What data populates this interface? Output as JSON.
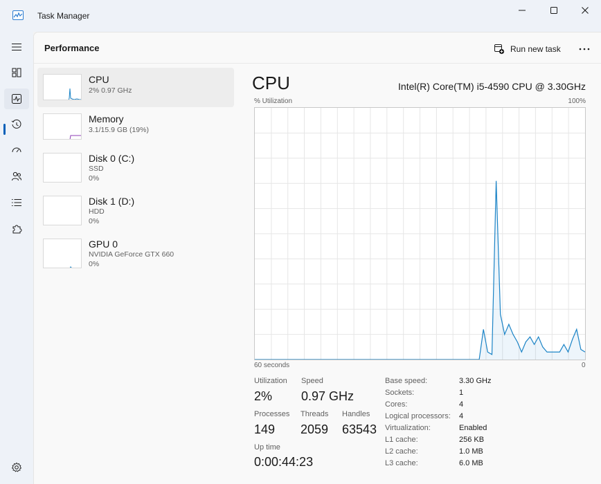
{
  "window": {
    "title": "Task Manager"
  },
  "nav": {
    "items": [
      {
        "name": "nav-processes",
        "icon": "hamburger-icon"
      },
      {
        "name": "nav-apps",
        "icon": "grid-icon"
      },
      {
        "name": "nav-performance",
        "icon": "pulse-icon",
        "active": true
      },
      {
        "name": "nav-app-history",
        "icon": "history-icon"
      },
      {
        "name": "nav-startup",
        "icon": "gauge-icon"
      },
      {
        "name": "nav-users",
        "icon": "users-icon"
      },
      {
        "name": "nav-details",
        "icon": "list-icon"
      },
      {
        "name": "nav-services",
        "icon": "puzzle-icon"
      }
    ],
    "settings_icon": "gear-icon"
  },
  "header": {
    "page_title": "Performance",
    "run_new_task": "Run new task"
  },
  "resources": [
    {
      "name": "CPU",
      "line1": "2%  0.97 GHz",
      "selected": true,
      "color": "#1a83c6"
    },
    {
      "name": "Memory",
      "line1": "3.1/15.9 GB (19%)",
      "color": "#8e3cb4"
    },
    {
      "name": "Disk 0 (C:)",
      "line1": "SSD",
      "line2": "0%",
      "color": "#4ca02a"
    },
    {
      "name": "Disk 1 (D:)",
      "line1": "HDD",
      "line2": "0%",
      "color": "#4ca02a"
    },
    {
      "name": "GPU 0",
      "line1": "NVIDIA GeForce GTX 660",
      "line2": "0%",
      "color": "#1a83c6"
    }
  ],
  "detail": {
    "title": "CPU",
    "model": "Intel(R) Core(TM) i5-4590 CPU @ 3.30GHz",
    "graph_label": "% Utilization",
    "graph_max": "100%",
    "graph_time": "60 seconds",
    "graph_min": "0",
    "line_color": "#1a83c6",
    "cpu_history_percent": [
      0,
      0,
      0,
      0,
      0,
      0,
      0,
      0,
      0,
      0,
      0,
      0,
      0,
      0,
      0,
      0,
      0,
      0,
      0,
      0,
      0,
      0,
      0,
      0,
      0,
      0,
      0,
      0,
      0,
      0,
      0,
      0,
      0,
      0,
      0,
      0,
      0,
      0,
      0,
      0,
      0,
      0,
      0,
      0,
      0,
      0,
      0,
      0,
      0,
      0,
      0,
      0,
      0,
      0,
      12,
      3,
      2,
      71,
      18,
      10,
      14,
      10,
      7,
      3,
      7,
      9,
      6,
      9,
      5,
      3,
      3,
      3,
      3,
      6,
      3,
      8,
      12,
      4,
      3
    ]
  },
  "stats": {
    "utilization_label": "Utilization",
    "utilization": "2%",
    "speed_label": "Speed",
    "speed": "0.97 GHz",
    "processes_label": "Processes",
    "processes": "149",
    "threads_label": "Threads",
    "threads": "2059",
    "handles_label": "Handles",
    "handles": "63543",
    "uptime_label": "Up time",
    "uptime": "0:00:44:23"
  },
  "info": {
    "base_speed_label": "Base speed:",
    "base_speed": "3.30 GHz",
    "sockets_label": "Sockets:",
    "sockets": "1",
    "cores_label": "Cores:",
    "cores": "4",
    "logical_label": "Logical processors:",
    "logical": "4",
    "virtualization_label": "Virtualization:",
    "virtualization": "Enabled",
    "l1_label": "L1 cache:",
    "l1": "256 KB",
    "l2_label": "L2 cache:",
    "l2": "1.0 MB",
    "l3_label": "L3 cache:",
    "l3": "6.0 MB"
  }
}
